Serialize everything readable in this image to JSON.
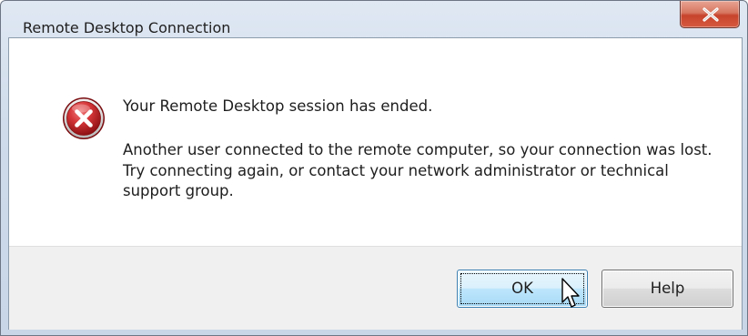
{
  "window": {
    "title": "Remote Desktop Connection"
  },
  "titlebar": {
    "close_icon": "close-x-icon"
  },
  "message": {
    "icon": "error-icon",
    "heading": "Your Remote Desktop session has ended.",
    "body": "Another user connected to the remote computer, so your connection was lost. Try connecting again, or contact your network administrator or technical support group."
  },
  "buttons": {
    "ok_label": "OK",
    "help_label": "Help"
  },
  "colors": {
    "close_button": "#c7432b",
    "error_icon": "#c1272d",
    "ok_button_focus": "#3c7fb1",
    "footer_background": "#f0f0f0"
  }
}
